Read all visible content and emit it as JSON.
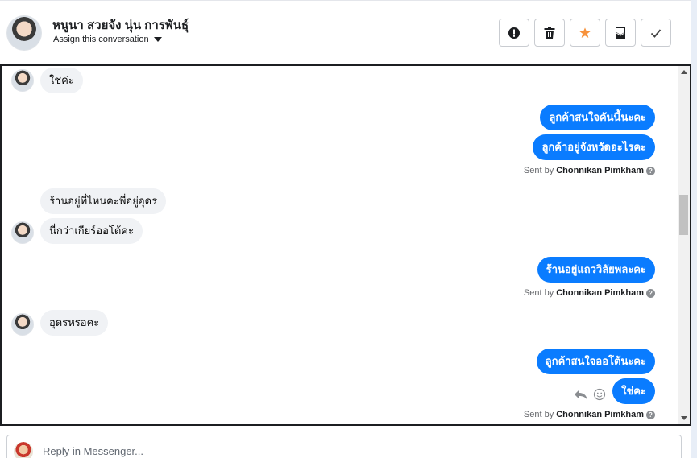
{
  "header": {
    "contact_name": "หนูนา สวยจัง นุ่น การพันธุ์",
    "assign_label": "Assign this conversation",
    "actions": [
      {
        "icon": "exclamation-icon"
      },
      {
        "icon": "trash-icon"
      },
      {
        "icon": "star-icon",
        "color": "#f7923b"
      },
      {
        "icon": "archive-icon"
      },
      {
        "icon": "check-icon"
      }
    ]
  },
  "messages": [
    {
      "dir": "in",
      "text": "ใช่ค่ะ"
    },
    {
      "dir": "out",
      "text": "ลูกค้าสนใจคันนี้นะคะ"
    },
    {
      "dir": "out",
      "text": "ลูกค้าอยู่จังหวัดอะไรคะ"
    },
    {
      "dir": "out",
      "text": "ร้านอยู่ที่ไหนคะพี่อยู่อุดร"
    },
    {
      "dir": "in",
      "text": "นี่กว่าเกียร์ออโต้ค่ะ"
    },
    {
      "dir": "out",
      "text": "ร้านอยู่แถววิลัยพละคะ"
    },
    {
      "dir": "in",
      "text": "อุดรหรอคะ"
    },
    {
      "dir": "out",
      "text": "ลูกค้าสนใจออโต้นะคะ"
    },
    {
      "dir": "out",
      "text": "ใช่คะ"
    }
  ],
  "sent_by": {
    "prefix": "Sent by",
    "name": "Chonnikan Pimkham"
  },
  "composer": {
    "placeholder": "Reply in Messenger..."
  },
  "colors": {
    "outgoing_bubble": "#0a7cff",
    "incoming_bubble": "#f0f2f5"
  }
}
